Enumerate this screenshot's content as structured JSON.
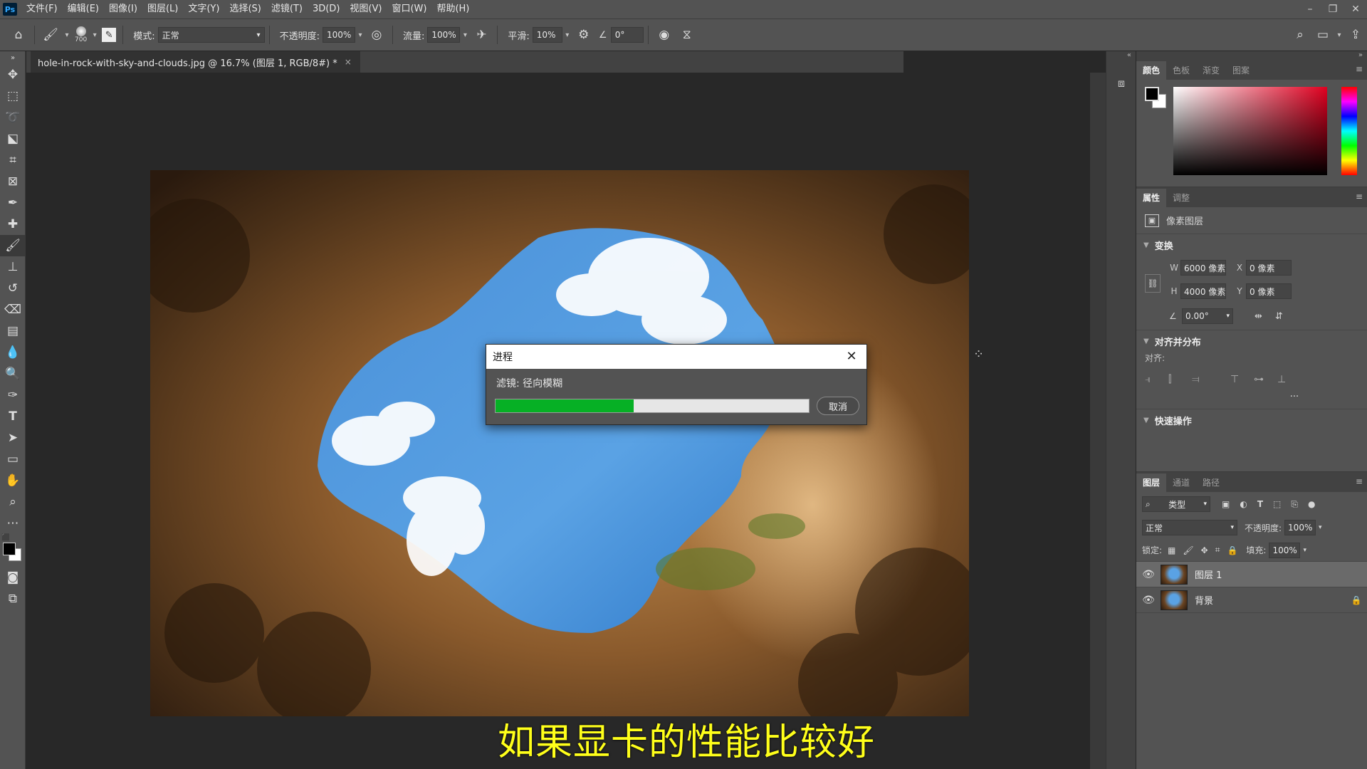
{
  "app": {
    "logo": "Ps"
  },
  "menubar": {
    "items": [
      "文件(F)",
      "编辑(E)",
      "图像(I)",
      "图层(L)",
      "文字(Y)",
      "选择(S)",
      "滤镜(T)",
      "3D(D)",
      "视图(V)",
      "窗口(W)",
      "帮助(H)"
    ],
    "window_controls": [
      "–",
      "❐",
      "✕"
    ]
  },
  "options": {
    "brush_size": "700",
    "mode_label": "模式:",
    "mode_value": "正常",
    "opacity_label": "不透明度:",
    "opacity_value": "100%",
    "flow_label": "流量:",
    "flow_value": "100%",
    "smoothing_label": "平滑:",
    "smoothing_value": "10%",
    "angle_value": "0°"
  },
  "document": {
    "tab_title": "hole-in-rock-with-sky-and-clouds.jpg @ 16.7% (图层 1, RGB/8#) *",
    "tab_close": "×"
  },
  "subtitle": "如果显卡的性能比较好",
  "color_panel": {
    "tabs": [
      "颜色",
      "色板",
      "渐变",
      "图案"
    ],
    "active_tab": 0
  },
  "properties_panel": {
    "tabs": [
      "属性",
      "调整"
    ],
    "layer_type": "像素图层",
    "transform_title": "变换",
    "w_label": "W",
    "w_value": "6000 像素",
    "h_label": "H",
    "h_value": "4000 像素",
    "x_label": "X",
    "x_value": "0 像素",
    "y_label": "Y",
    "y_value": "0 像素",
    "angle_value": "0.00°",
    "align_title": "对齐并分布",
    "align_label": "对齐:",
    "more": "···",
    "quick_actions_title": "快速操作"
  },
  "layers_panel": {
    "tabs": [
      "图层",
      "通道",
      "路径"
    ],
    "filter_kind": "类型",
    "blend_mode": "正常",
    "opacity_label": "不透明度:",
    "opacity_value": "100%",
    "lock_label": "锁定:",
    "fill_label": "填充:",
    "fill_value": "100%",
    "layers": [
      {
        "name": "图层 1",
        "active": true
      },
      {
        "name": "背景",
        "locked": true
      }
    ]
  },
  "dialog": {
    "title": "进程",
    "status": "滤镜: 径向模糊",
    "progress_percent": 44,
    "cancel_label": "取消",
    "close": "✕"
  },
  "colors": {
    "progress": "#06b025",
    "subtitle": "#ffff1a"
  }
}
